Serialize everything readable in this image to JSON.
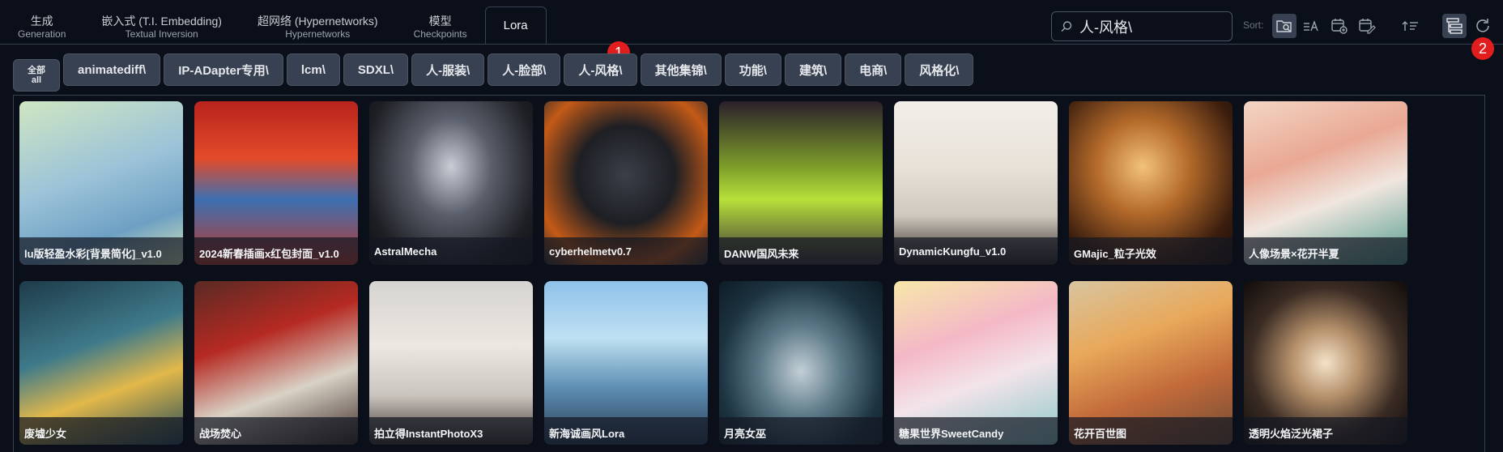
{
  "tabs": [
    {
      "label": "生成",
      "sub": "Generation"
    },
    {
      "label": "嵌入式 (T.I. Embedding)",
      "sub": "Textual Inversion"
    },
    {
      "label": "超网络 (Hypernetworks)",
      "sub": "Hypernetworks"
    },
    {
      "label": "模型",
      "sub": "Checkpoints"
    },
    {
      "label": "Lora",
      "sub": ""
    }
  ],
  "active_tab": "Lora",
  "search": {
    "value": "人-风格\\",
    "placeholder": ""
  },
  "sort_label": "Sort:",
  "badges": [
    "1",
    "2"
  ],
  "categories": {
    "all_line1": "全部",
    "all_line2": "all",
    "items": [
      "animatediff\\",
      "IP-ADapter专用\\",
      "lcm\\",
      "SDXL\\",
      "人-服装\\",
      "人-脸部\\",
      "人-风格\\",
      "其他集锦\\",
      "功能\\",
      "建筑\\",
      "电商\\",
      "风格化\\"
    ]
  },
  "cards": [
    {
      "title": "lu版轻盈水彩[背景简化]_v1.0",
      "bg": "linear-gradient(160deg,#cfe6c2 0%,#9cc3d8 45%,#6ea0c4 75%,#d8e8b8 100%)"
    },
    {
      "title": "2024新春插画x红包封面_v1.0",
      "bg": "linear-gradient(180deg,#b8231d 0%,#e34b2a 35%,#3d6fb0 60%,#c0392b 100%)"
    },
    {
      "title": "AstralMecha",
      "bg": "radial-gradient(ellipse at 50% 40%,#c9cdd6 0%,#5a5f6b 35%,#1e1f24 75%,#0f1013 100%)"
    },
    {
      "title": "cyberhelmetv0.7",
      "bg": "radial-gradient(circle at 50% 45%,#3b3f48 0%,#1d1f24 40%,#c45a17 75%,#2a2b30 100%)"
    },
    {
      "title": "DANW国风未来",
      "bg": "linear-gradient(180deg,#2a1f2a 0%,#7d9d2a 40%,#b6e03a 60%,#3a2e3a 100%)"
    },
    {
      "title": "DynamicKungfu_v1.0",
      "bg": "linear-gradient(180deg,#f2efea 0%,#e8e2d8 40%,#cfc8bd 70%,#2a2422 100%)"
    },
    {
      "title": "GMajic_粒子光效",
      "bg": "radial-gradient(circle at 45% 40%,#f3c27a 0%,#b46a2a 35%,#3a1d0e 75%,#1a0d06 100%)"
    },
    {
      "title": "人像场景×花开半夏",
      "bg": "linear-gradient(160deg,#f3d6c4 0%,#e9a894 35%,#f0e6df 60%,#4f9a8c 100%)"
    },
    {
      "title": "废墟少女",
      "bg": "linear-gradient(160deg,#1e3b4a 0%,#3f7a8a 40%,#e2b84a 65%,#204a5a 100%)"
    },
    {
      "title": "战场焚心",
      "bg": "linear-gradient(160deg,#5a2a24 0%,#b52a22 35%,#d9d2c6 65%,#3b2a26 100%)"
    },
    {
      "title": "拍立得InstantPhotoX3",
      "bg": "linear-gradient(180deg,#d6d4d1 0%,#ece7e1 40%,#c9c4bd 70%,#3a2f2c 100%)"
    },
    {
      "title": "新海诚画风Lora",
      "bg": "linear-gradient(180deg,#8ec2ea 0%,#bfe0f2 35%,#5d8fb3 65%,#2b3d55 100%)"
    },
    {
      "title": "月亮女巫",
      "bg": "radial-gradient(ellipse at 50% 55%,#c3cfd6 0%,#5d7a88 35%,#1c3340 70%,#0e1c25 100%)"
    },
    {
      "title": "糖果世界SweetCandy",
      "bg": "linear-gradient(160deg,#f6e7a9 0%,#f4b8c6 35%,#f3e4ea 60%,#8cc7c8 100%)"
    },
    {
      "title": "花开百世图",
      "bg": "linear-gradient(160deg,#d8c5a0 0%,#e8a85a 35%,#c26a3a 65%,#6d4a34 100%)"
    },
    {
      "title": "透明火焰泛光裙子",
      "bg": "radial-gradient(ellipse at 50% 50%,#f4e2c8 0%,#b48f6a 30%,#3b2c24 65%,#0f0c0b 100%)"
    }
  ]
}
